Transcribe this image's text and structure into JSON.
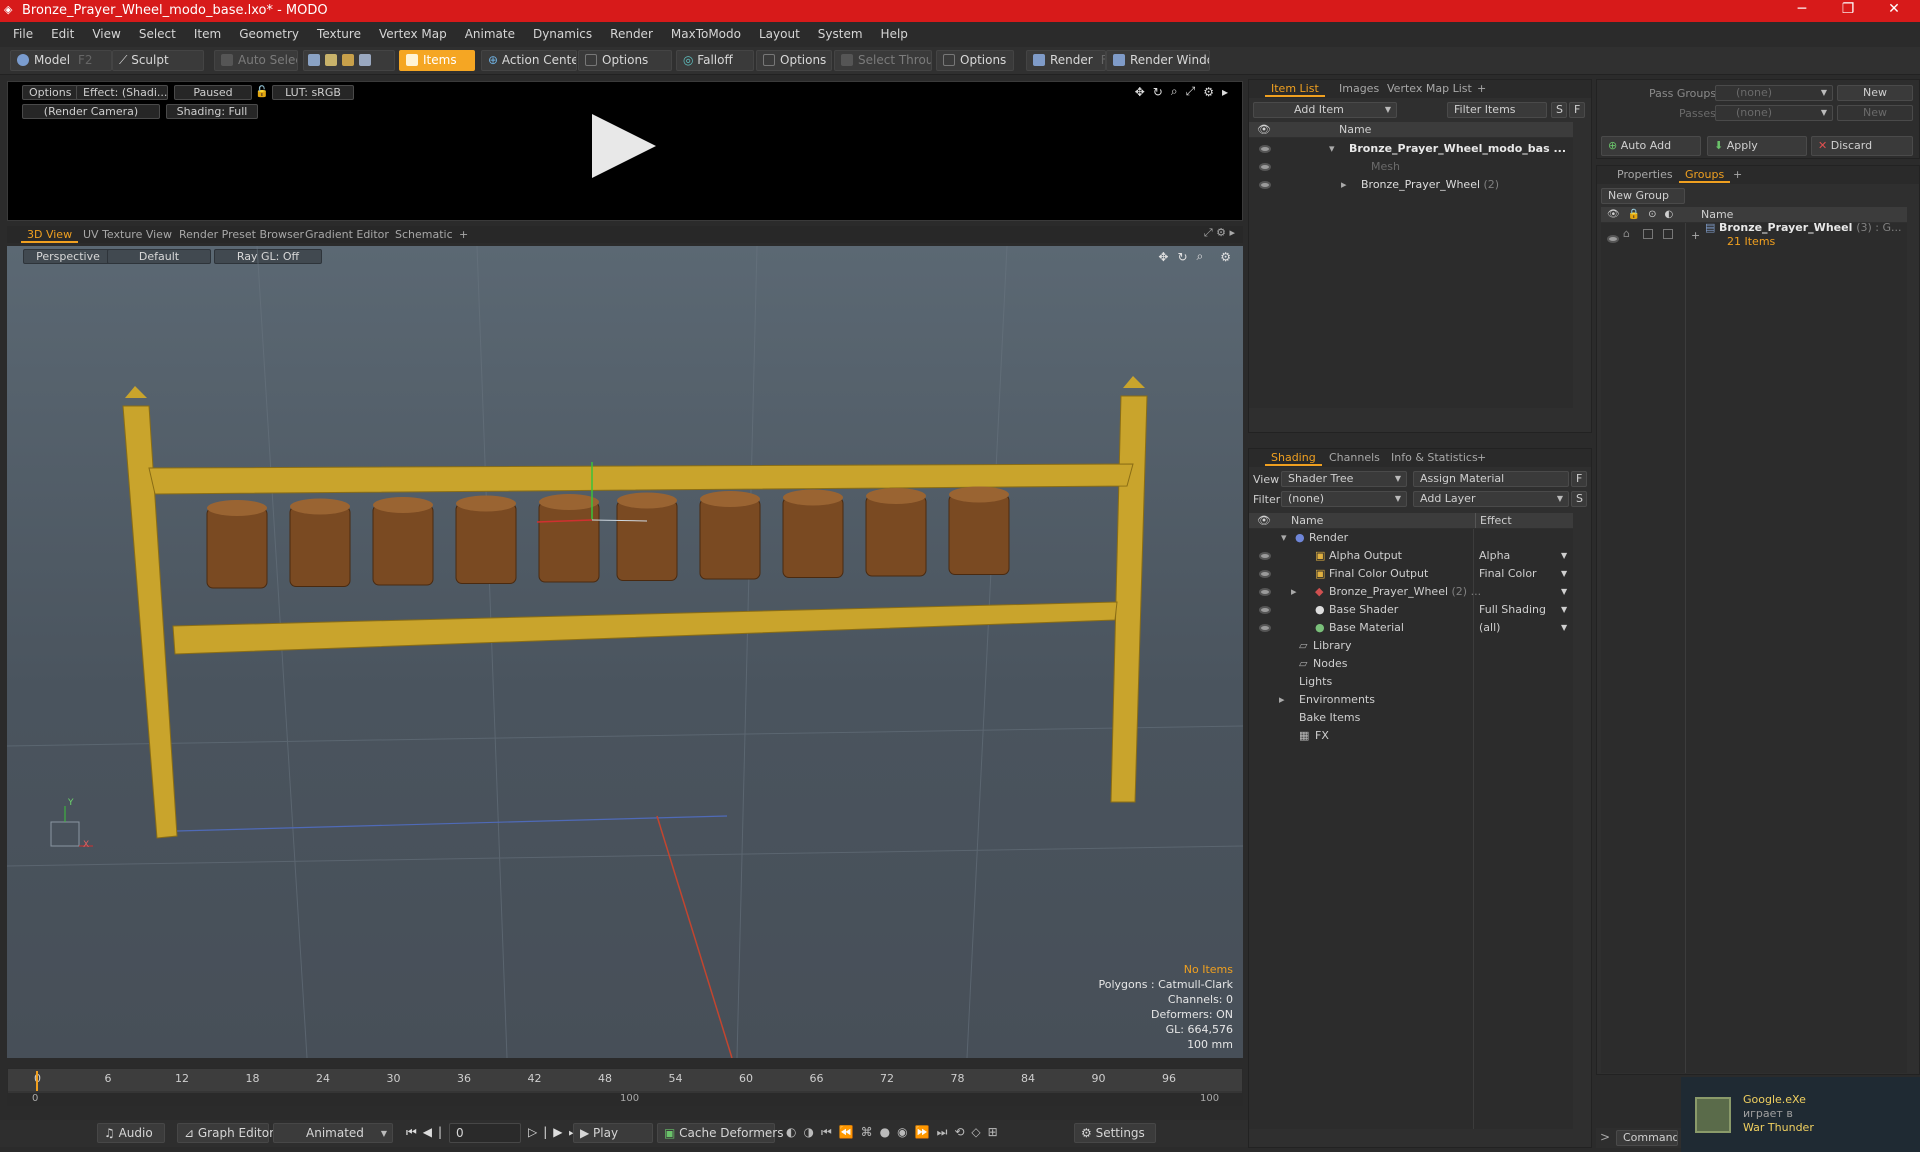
{
  "window": {
    "title": "Bronze_Prayer_Wheel_modo_base.lxo* - MODO",
    "min": "─",
    "max": "❐",
    "close": "✕"
  },
  "menu": [
    "File",
    "Edit",
    "View",
    "Select",
    "Item",
    "Geometry",
    "Texture",
    "Vertex Map",
    "Animate",
    "Dynamics",
    "Render",
    "MaxToModo",
    "Layout",
    "System",
    "Help"
  ],
  "toolbar": {
    "model": "Model",
    "model_key": "F2",
    "sculpt": "Sculpt",
    "auto_select": "Auto Select",
    "items": "Items",
    "action_center": "Action Center",
    "options1": "Options",
    "falloff": "Falloff",
    "options2": "Options",
    "select_through": "Select Through",
    "options3": "Options",
    "render": "Render",
    "render_key": "F9",
    "render_window": "Render Window"
  },
  "preview": {
    "options": "Options",
    "effect": "Effect: (Shadi...",
    "paused": "Paused",
    "lut": "LUT: sRGB",
    "camera": "(Render Camera)",
    "shading": "Shading: Full"
  },
  "viewport_tabs": [
    "3D View",
    "UV Texture View",
    "Render Preset Browser",
    "Gradient Editor",
    "Schematic",
    "+"
  ],
  "viewport": {
    "projection": "Perspective",
    "style": "Default",
    "raygl": "Ray GL: Off",
    "info": {
      "items": "No Items",
      "polygons": "Polygons : Catmull-Clark",
      "channels": "Channels: 0",
      "deformers": "Deformers: ON",
      "gl": "GL: 664,576",
      "scale": "100 mm"
    },
    "axis_y": "Y",
    "axis_x": "X"
  },
  "timeline": {
    "ticks": [
      "0",
      "6",
      "12",
      "18",
      "24",
      "30",
      "36",
      "42",
      "48",
      "54",
      "60",
      "66",
      "72",
      "78",
      "84",
      "90",
      "96"
    ],
    "range_start": "0",
    "range_mid": "100",
    "range_end": "100"
  },
  "bottom": {
    "audio": "Audio",
    "graph_editor": "Graph Editor",
    "animated": "Animated",
    "frame": "0",
    "play": "Play",
    "cache": "Cache Deformers",
    "settings": "Settings"
  },
  "item_list": {
    "tabs": [
      "Item List",
      "Images",
      "Vertex Map List",
      "+"
    ],
    "add_item": "Add Item",
    "filter": "Filter Items",
    "s": "S",
    "f": "F",
    "col_name": "Name",
    "rows": [
      {
        "name": "Bronze_Prayer_Wheel_modo_bas ...",
        "count": ""
      },
      {
        "name": "Mesh",
        "count": ""
      },
      {
        "name": "Bronze_Prayer_Wheel",
        "count": "(2)"
      }
    ]
  },
  "shading": {
    "tabs": [
      "Shading",
      "Channels",
      "Info & Statistics",
      "+"
    ],
    "view_label": "View",
    "view_value": "Shader Tree",
    "assign": "Assign Material",
    "f": "F",
    "filter_label": "Filter",
    "filter_value": "(none)",
    "add_layer": "Add Layer",
    "s": "S",
    "col_name": "Name",
    "col_effect": "Effect",
    "rows": [
      {
        "name": "Render",
        "effect": ""
      },
      {
        "name": "Alpha Output",
        "effect": "Alpha"
      },
      {
        "name": "Final Color Output",
        "effect": "Final Color"
      },
      {
        "name": "Bronze_Prayer_Wheel",
        "count": "(2) ...",
        "effect": ""
      },
      {
        "name": "Base Shader",
        "effect": "Full Shading"
      },
      {
        "name": "Base Material",
        "effect": "(all)"
      },
      {
        "name": "Library",
        "effect": ""
      },
      {
        "name": "Nodes",
        "effect": ""
      },
      {
        "name": "Lights",
        "effect": ""
      },
      {
        "name": "Environments",
        "effect": ""
      },
      {
        "name": "Bake Items",
        "effect": ""
      },
      {
        "name": "FX",
        "effect": ""
      }
    ]
  },
  "passes": {
    "pass_groups": "Pass Groups",
    "pass_groups_val": "(none)",
    "new1": "New",
    "passes": "Passes",
    "passes_val": "(none)",
    "new2": "New",
    "auto_add": "Auto Add",
    "apply": "Apply",
    "discard": "Discard"
  },
  "groups": {
    "tabs": [
      "Properties",
      "Groups",
      "+"
    ],
    "new_group": "New Group",
    "col_name": "Name",
    "group_name": "Bronze_Prayer_Wheel",
    "group_count": "(3) : G...",
    "group_items": "21 Items"
  },
  "command": {
    "arrow": ">",
    "label": "Command"
  },
  "notification": {
    "app": "Google.eXe",
    "status": "играет в",
    "game": "War Thunder"
  },
  "colors": {
    "titlebar": "#d71a1a",
    "accent": "#f0a020",
    "rail": "#c9a42c"
  }
}
